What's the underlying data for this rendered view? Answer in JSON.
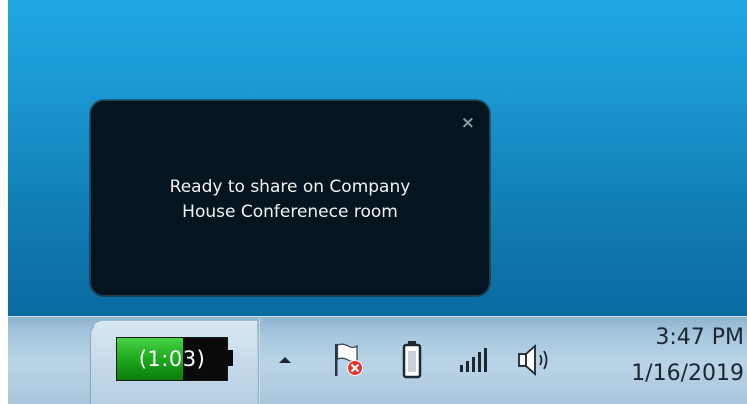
{
  "notification": {
    "message": "Ready to share on Company\nHouse Conferenece room",
    "close_glyph": "×"
  },
  "taskbar": {
    "battery_timer": "(1:03)",
    "battery_fill_fraction": 0.6,
    "clock": {
      "time": "3:47 PM",
      "date": "1/16/2019"
    }
  },
  "tray": {
    "icons": [
      "show-hidden-icons-arrow-icon",
      "action-center-flag-icon",
      "battery-icon",
      "network-signal-icon",
      "volume-speaker-icon"
    ]
  },
  "colors": {
    "desktop": "#1a97d1",
    "toast_bg": "#04151f",
    "battery_green": "#1ca91c",
    "error_red": "#e0342b"
  }
}
